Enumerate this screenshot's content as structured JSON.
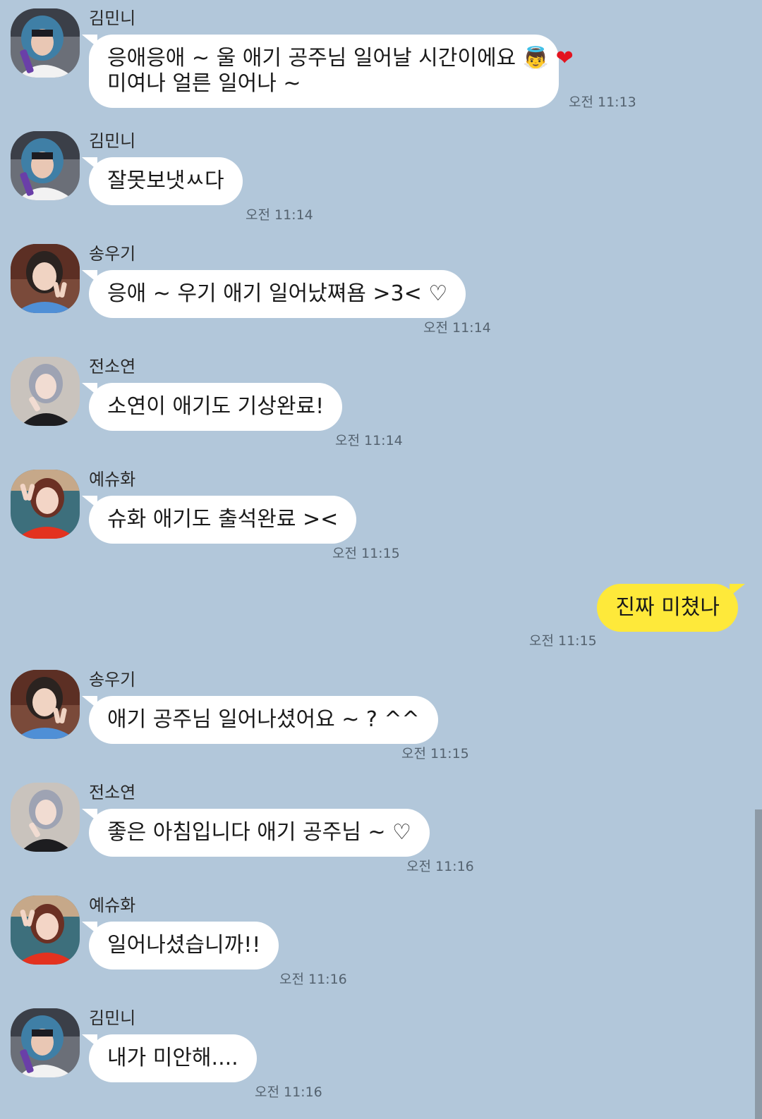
{
  "colors": {
    "background": "#b2c7da",
    "incoming_bubble": "#ffffff",
    "outgoing_bubble": "#fee93a",
    "timestamp": "#54626f"
  },
  "messages": [
    {
      "sender": "김민니",
      "avatar": "avatar-blue-hood",
      "lines": [
        "응애응애 ~ 울 애기 공주님 일어날 시간이에요",
        "미여나 얼른 일어나 ~"
      ],
      "emojis": [
        "👼",
        "❤"
      ],
      "time": "오전 11:13"
    },
    {
      "sender": "김민니",
      "avatar": "avatar-blue-hood",
      "lines": [
        "잘못보냇ㅆ다"
      ],
      "time": "오전 11:14"
    },
    {
      "sender": "송우기",
      "avatar": "avatar-peace-sign",
      "lines": [
        "응애 ~ 우기 애기 일어났쪄욤 >3< ♡"
      ],
      "time": "오전 11:14"
    },
    {
      "sender": "전소연",
      "avatar": "avatar-silver-hair",
      "lines": [
        "소연이 애기도 기상완료!"
      ],
      "time": "오전 11:14"
    },
    {
      "sender": "예슈화",
      "avatar": "avatar-red-outfit",
      "lines": [
        "슈화 애기도 출석완료 ><"
      ],
      "time": "오전 11:15"
    },
    {
      "mine": true,
      "lines": [
        "진짜 미쳤나"
      ],
      "time": "오전 11:15"
    },
    {
      "sender": "송우기",
      "avatar": "avatar-peace-sign",
      "lines": [
        "애기 공주님 일어나셨어요 ~ ? ^^"
      ],
      "time": "오전 11:15"
    },
    {
      "sender": "전소연",
      "avatar": "avatar-silver-hair",
      "lines": [
        "좋은 아침입니다 애기 공주님 ~ ♡"
      ],
      "time": "오전 11:16"
    },
    {
      "sender": "예슈화",
      "avatar": "avatar-red-outfit",
      "lines": [
        "일어나셨습니까!!"
      ],
      "time": "오전 11:16"
    },
    {
      "sender": "김민니",
      "avatar": "avatar-blue-hood",
      "lines": [
        "내가 미안해...."
      ],
      "time": "오전 11:16"
    }
  ]
}
